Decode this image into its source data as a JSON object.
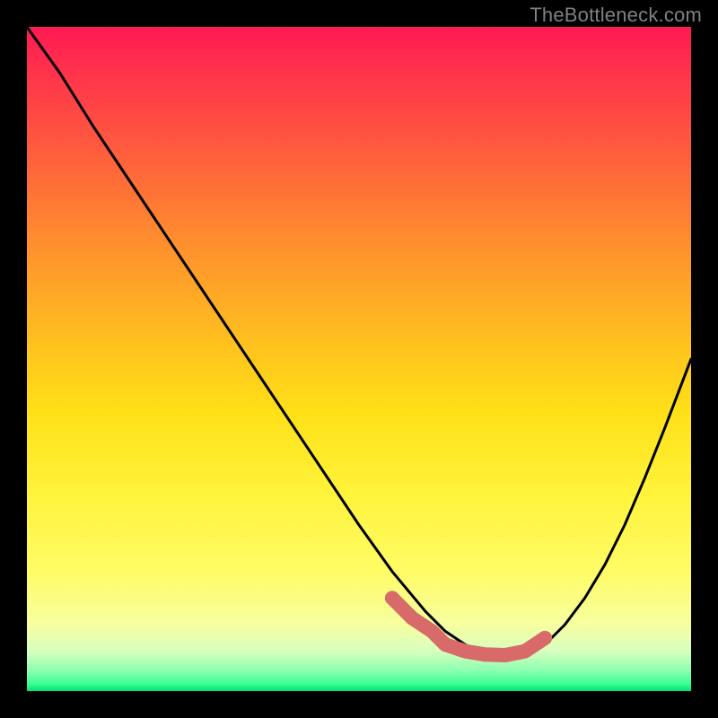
{
  "watermark": "TheBottleneck.com",
  "colors": {
    "frame": "#000000",
    "curve": "#000000",
    "highlight": "#d86a6a"
  },
  "chart_data": {
    "type": "line",
    "title": "",
    "xlabel": "",
    "ylabel": "",
    "xlim": [
      0,
      100
    ],
    "ylim": [
      0,
      100
    ],
    "grid": false,
    "legend": false,
    "note": "Two black curve segments (right branch truncated at x=100) plus a pink highlight near the minimum; values estimated from pixels on a 0–100 normalized scale",
    "series": [
      {
        "name": "left_branch",
        "color": "#000000",
        "x": [
          0,
          5,
          10,
          15,
          20,
          25,
          30,
          35,
          40,
          45,
          50,
          55,
          60,
          63,
          66,
          69,
          72
        ],
        "y": [
          100,
          93,
          85,
          77.5,
          70,
          62.5,
          55,
          47.5,
          40,
          32.5,
          25,
          18,
          12,
          9,
          7,
          5.5,
          5
        ]
      },
      {
        "name": "right_branch",
        "color": "#000000",
        "x": [
          72,
          75,
          78,
          81,
          84,
          87,
          90,
          93,
          96,
          100
        ],
        "y": [
          5,
          5.5,
          7,
          10,
          14,
          19,
          25,
          32,
          39.5,
          50
        ]
      },
      {
        "name": "highlight_segment",
        "color": "#d86a6a",
        "x": [
          55,
          58,
          61,
          63,
          66,
          69,
          72,
          75,
          78
        ],
        "y": [
          14,
          11,
          9,
          7,
          6,
          5.5,
          5.4,
          6,
          8
        ]
      },
      {
        "name": "highlight_dots",
        "color": "#d86a6a",
        "type": "scatter",
        "x": [
          55,
          58
        ],
        "y": [
          14,
          11
        ]
      }
    ]
  }
}
